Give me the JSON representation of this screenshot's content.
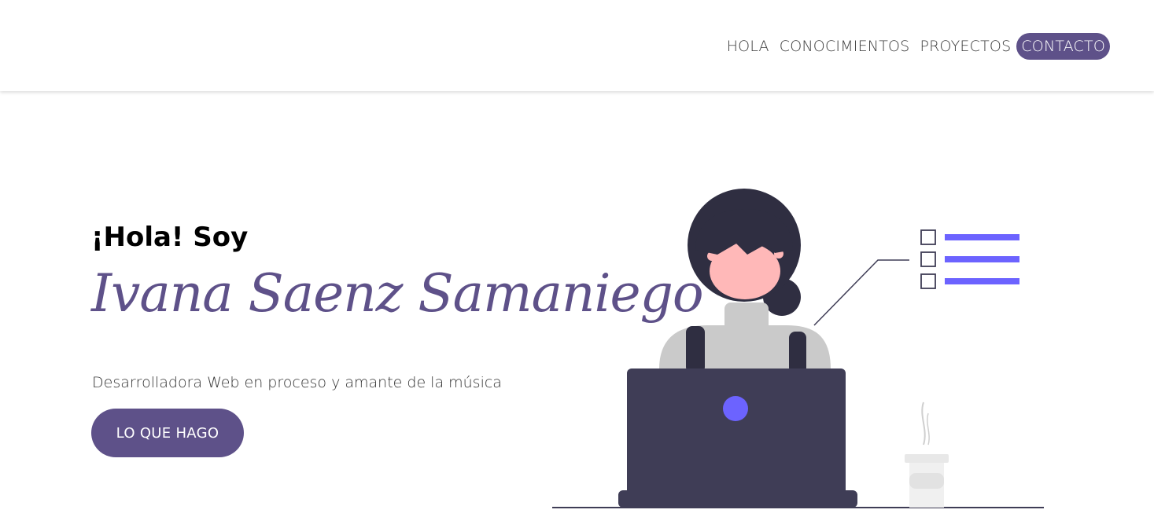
{
  "nav": {
    "items": [
      {
        "label": "HOLA"
      },
      {
        "label": "CONOCIMIENTOS"
      },
      {
        "label": "PROYECTOS"
      },
      {
        "label": "CONTACTO",
        "active": true
      }
    ]
  },
  "hero": {
    "greeting": "¡Hola! Soy",
    "name": "Ivana Saenz Samaniego",
    "subtitle": "Desarrolladora Web en proceso y amante de la música",
    "cta_label": "LO QUE HAGO"
  },
  "colors": {
    "accent": "#5e5189",
    "illustration_accent": "#6c63ff",
    "laptop": "#3f3d56",
    "hair": "#2f2e41",
    "skin": "#ffb8b8"
  },
  "icons": {
    "illustration": "woman-with-laptop-illustration",
    "checklist": "checklist-icon"
  }
}
